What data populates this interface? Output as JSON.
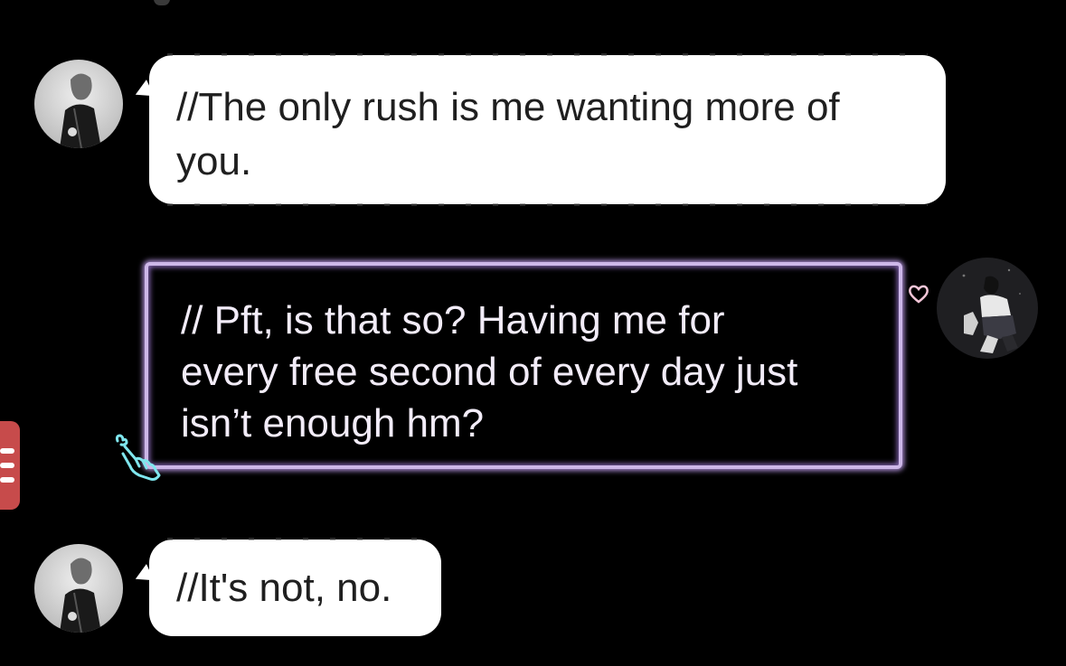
{
  "messages": [
    {
      "sender": "left",
      "text_line1": "//The only rush is me wanting more of",
      "text_line2": "you."
    },
    {
      "sender": "right",
      "line1": "// Pft, is that so? Having me for",
      "line2": "every free second of every day just",
      "line3": "isn’t enough hm?"
    },
    {
      "sender": "left",
      "text": "//It's not, no."
    }
  ],
  "colors": {
    "background": "#000000",
    "bubble_white": "#ffffff",
    "neon_border": "#cdb7e8",
    "menu_tab": "#c74b4b",
    "hand_icon": "#7fe6ee"
  },
  "icons": {
    "heart": "heart-icon",
    "hand": "finger-heart-hand-icon",
    "menu": "hamburger-menu-icon"
  }
}
